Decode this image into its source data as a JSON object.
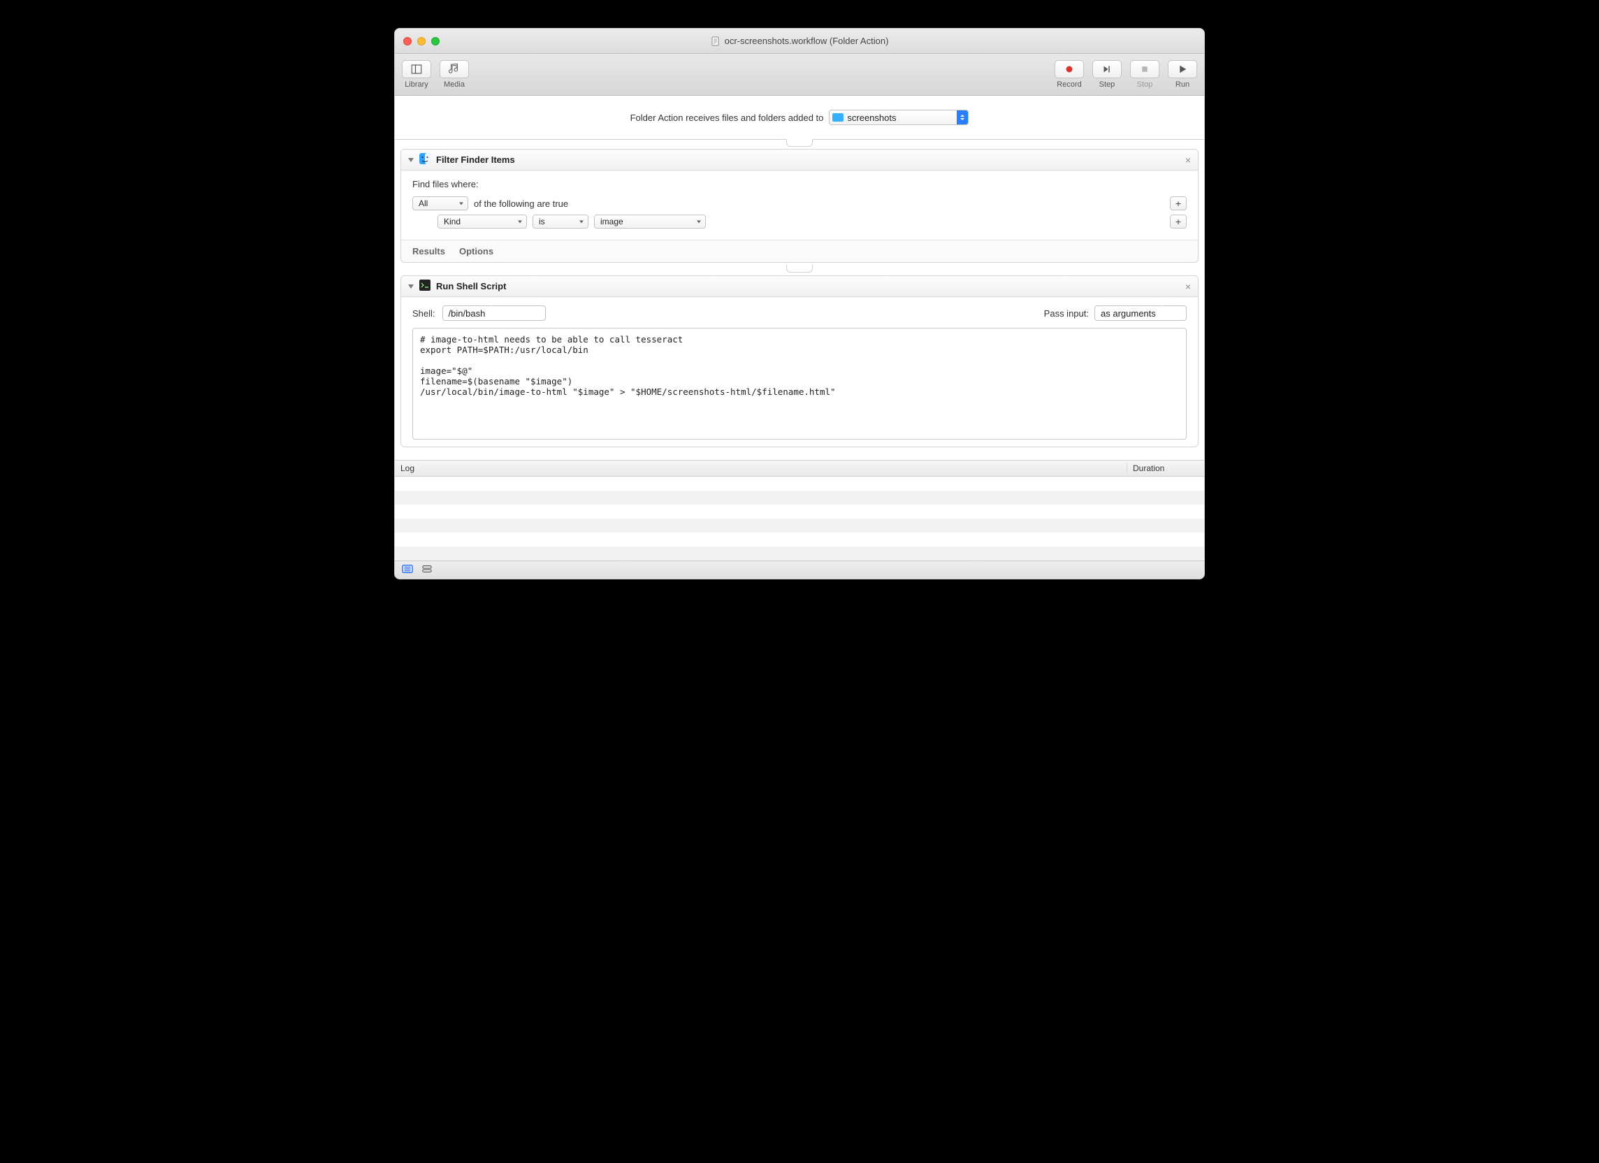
{
  "window": {
    "title": "ocr-screenshots.workflow (Folder Action)"
  },
  "toolbar": {
    "library": "Library",
    "media": "Media",
    "record": "Record",
    "step": "Step",
    "stop": "Stop",
    "run": "Run"
  },
  "receives": {
    "text": "Folder Action receives files and folders added to",
    "folder": "screenshots"
  },
  "action1": {
    "title": "Filter Finder Items",
    "prompt": "Find files where:",
    "match_scope": "All",
    "match_text": "of the following are true",
    "rule_attribute": "Kind",
    "rule_operator": "is",
    "rule_value": "image",
    "footer_results": "Results",
    "footer_options": "Options"
  },
  "action2": {
    "title": "Run Shell Script",
    "shell_label": "Shell:",
    "shell_value": "/bin/bash",
    "pass_input_label": "Pass input:",
    "pass_input_value": "as arguments",
    "script": "# image-to-html needs to be able to call tesseract\nexport PATH=$PATH:/usr/local/bin\n\nimage=\"$@\"\nfilename=$(basename \"$image\")\n/usr/local/bin/image-to-html \"$image\" > \"$HOME/screenshots-html/$filename.html\""
  },
  "log": {
    "log_header": "Log",
    "duration_header": "Duration"
  }
}
